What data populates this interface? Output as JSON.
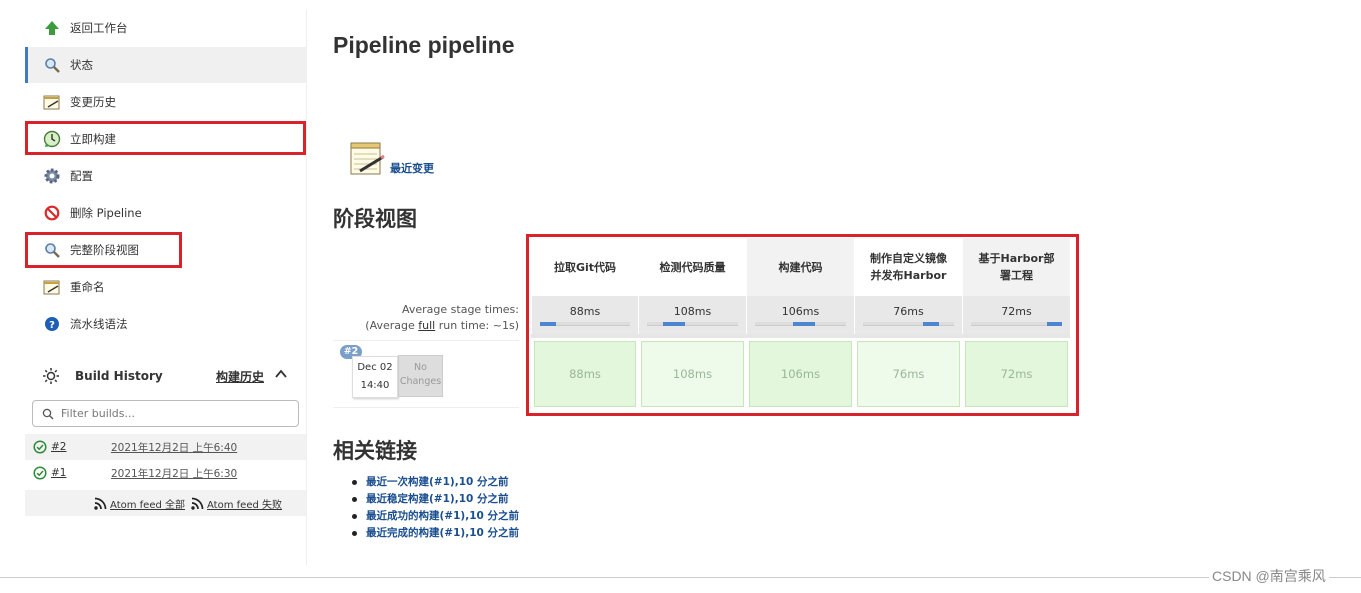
{
  "sidebar": {
    "items": [
      {
        "label": "返回工作台",
        "icon": "up-arrow-icon"
      },
      {
        "label": "状态",
        "icon": "magnifier-icon"
      },
      {
        "label": "变更历史",
        "icon": "notepad-icon"
      },
      {
        "label": "立即构建",
        "icon": "build-clock-icon"
      },
      {
        "label": "配置",
        "icon": "gear-icon"
      },
      {
        "label": "删除 Pipeline",
        "icon": "no-entry-icon"
      },
      {
        "label": "完整阶段视图",
        "icon": "magnifier-icon"
      },
      {
        "label": "重命名",
        "icon": "notepad-icon"
      },
      {
        "label": "流水线语法",
        "icon": "help-icon"
      }
    ]
  },
  "build_history": {
    "title": "Build History",
    "title_cn": "构建历史",
    "filter_placeholder": "Filter builds...",
    "builds": [
      {
        "number": "#2",
        "date": "2021年12月2日 上午6:40",
        "status_color": "#2e8b3a"
      },
      {
        "number": "#1",
        "date": "2021年12月2日 上午6:30",
        "status_color": "#2e8b3a"
      }
    ],
    "feed_all": "Atom feed 全部",
    "feed_fail": "Atom feed 失败"
  },
  "main": {
    "title": "Pipeline pipeline",
    "recent_changes": "最近变更",
    "stage_view_title": "阶段视图",
    "related_title": "相关链接"
  },
  "stage_view": {
    "stages": [
      {
        "name": "拉取Git代码",
        "avg": "88ms",
        "run": "88ms"
      },
      {
        "name": "检测代码质量",
        "avg": "108ms",
        "run": "108ms"
      },
      {
        "name": "构建代码",
        "avg": "106ms",
        "run": "106ms"
      },
      {
        "name": "制作自定义镜像并发布Harbor",
        "avg": "76ms",
        "run": "76ms"
      },
      {
        "name": "基于Harbor部署工程",
        "avg": "72ms",
        "run": "72ms"
      }
    ],
    "avg_label_line1": "Average stage times:",
    "avg_label_line2_pre": "(Average ",
    "avg_label_line2_link": "full",
    "avg_label_line2_post": " run time: ~1s)",
    "build_badge": "#2",
    "build_date": "Dec 02",
    "build_time": "14:40",
    "no_changes_line1": "No",
    "no_changes_line2": "Changes",
    "stage_fill_colors": {
      "header_alt": "#ffffff",
      "header": "#f2f2f2",
      "success": "#e2f7dc",
      "bar": "#4d86cf"
    }
  },
  "related_links": [
    "最近一次构建(#1),10 分之前",
    "最近稳定构建(#1),10 分之前",
    "最近成功的构建(#1),10 分之前",
    "最近完成的构建(#1),10 分之前"
  ],
  "highlight_color": "#d9232a",
  "watermark": "CSDN @南宫乘风"
}
